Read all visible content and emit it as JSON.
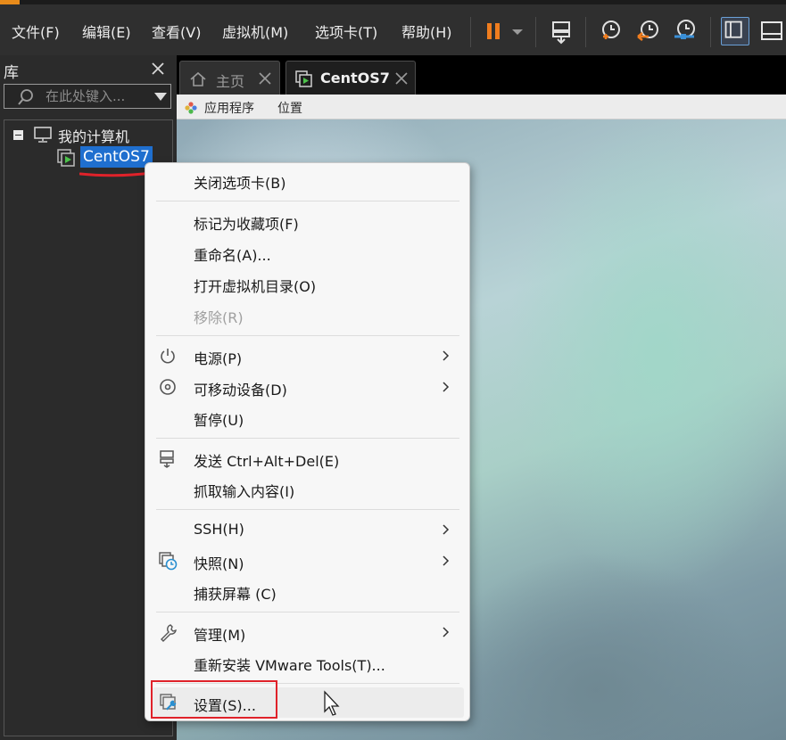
{
  "menubar": {
    "items": [
      "文件(F)",
      "编辑(E)",
      "查看(V)",
      "虚拟机(M)",
      "选项卡(T)",
      "帮助(H)"
    ]
  },
  "toolbar": {
    "icons": [
      "pause-icon",
      "dropdown-caret-icon",
      "send-ctrl-alt-del-icon",
      "snapshot-take-icon",
      "snapshot-revert-icon",
      "snapshot-manager-icon",
      "library-panel-icon",
      "thumbnail-bar-icon"
    ],
    "accent_color": "#f07d1e"
  },
  "library": {
    "title": "库",
    "search_placeholder": "在此处键入...",
    "tree": {
      "root_label": "我的计算机",
      "vm_label": "CentOS7"
    }
  },
  "tabs": [
    {
      "label": "主页",
      "icon": "home-icon"
    },
    {
      "label": "CentOS7",
      "icon": "vm-icon"
    }
  ],
  "guest": {
    "apps_label": "应用程序",
    "places_label": "位置"
  },
  "context_menu": {
    "items": [
      {
        "label": "关闭选项卡(B)"
      },
      {
        "label": "标记为收藏项(F)"
      },
      {
        "label": "重命名(A)..."
      },
      {
        "label": "打开虚拟机目录(O)"
      },
      {
        "label": "移除(R)",
        "disabled": true
      },
      {
        "label": "电源(P)",
        "icon": "power-icon",
        "submenu": true
      },
      {
        "label": "可移动设备(D)",
        "icon": "disc-icon",
        "submenu": true
      },
      {
        "label": "暂停(U)"
      },
      {
        "label": "发送 Ctrl+Alt+Del(E)",
        "icon": "send-keys-icon"
      },
      {
        "label": "抓取输入内容(I)"
      },
      {
        "label": "SSH(H)",
        "submenu": true
      },
      {
        "label": "快照(N)",
        "icon": "snapshot-icon",
        "submenu": true
      },
      {
        "label": "捕获屏幕 (C)"
      },
      {
        "label": "管理(M)",
        "icon": "wrench-icon",
        "submenu": true
      },
      {
        "label": "重新安装 VMware Tools(T)..."
      },
      {
        "label": "设置(S)...",
        "icon": "settings-vm-icon",
        "hovered": true
      }
    ]
  },
  "colors": {
    "selection": "#1f6fcf",
    "highlight_box": "#e0222a"
  }
}
